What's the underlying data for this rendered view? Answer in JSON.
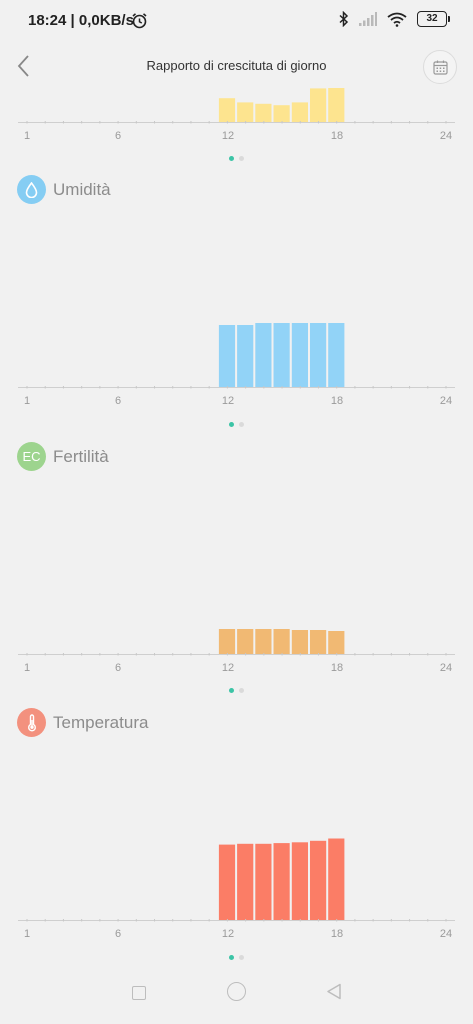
{
  "status_bar": {
    "time": "18:24",
    "network_speed": "| 0,0KB/s",
    "battery": "32"
  },
  "header": {
    "title": "Rapporto di crescituta di giorno"
  },
  "x_axis_labels": [
    "1",
    "6",
    "12",
    "18",
    "24"
  ],
  "sections": [
    {
      "id": "light",
      "title": "",
      "icon": "sun-icon",
      "color": "#fde48f"
    },
    {
      "id": "humidity",
      "title": "Umidità",
      "icon": "water-drop-icon",
      "icon_color": "#85cdf3",
      "color": "#92d3f7"
    },
    {
      "id": "fertility",
      "title": "Fertilità",
      "icon": "ec-icon",
      "icon_text": "EC",
      "icon_color": "#9dd48e",
      "color": "#f1b973"
    },
    {
      "id": "temperature",
      "title": "Temperatura",
      "icon": "thermometer-icon",
      "icon_color": "#f3917e",
      "color": "#fb7d66"
    }
  ],
  "chart_data": [
    {
      "type": "bar",
      "x": [
        12,
        13,
        14,
        15,
        16,
        17,
        18
      ],
      "values": [
        17,
        14,
        13,
        12,
        14,
        24,
        26
      ],
      "xlim": [
        1,
        24
      ],
      "ylim": [
        0,
        100
      ],
      "xticks": [
        1,
        6,
        12,
        18,
        24
      ],
      "color": "#fde48f"
    },
    {
      "type": "bar",
      "x": [
        12,
        13,
        14,
        15,
        16,
        17,
        18
      ],
      "values": [
        62,
        62,
        64,
        64,
        64,
        64,
        64
      ],
      "xlim": [
        1,
        24
      ],
      "ylim": [
        0,
        100
      ],
      "xticks": [
        1,
        6,
        12,
        18,
        24
      ],
      "title": "Umidità",
      "color": "#92d3f7"
    },
    {
      "type": "bar",
      "x": [
        12,
        13,
        14,
        15,
        16,
        17,
        18
      ],
      "values": [
        25,
        25,
        25,
        25,
        24,
        24,
        23
      ],
      "xlim": [
        1,
        24
      ],
      "ylim": [
        0,
        100
      ],
      "xticks": [
        1,
        6,
        12,
        18,
        24
      ],
      "title": "Fertilità",
      "color": "#f1b973"
    },
    {
      "type": "bar",
      "x": [
        12,
        13,
        14,
        15,
        16,
        17,
        18
      ],
      "values": [
        98,
        99,
        99,
        100,
        101,
        103,
        106
      ],
      "xlim": [
        1,
        24
      ],
      "ylim": [
        0,
        130
      ],
      "xticks": [
        1,
        6,
        12,
        18,
        24
      ],
      "title": "Temperatura",
      "color": "#fb7d66"
    }
  ]
}
